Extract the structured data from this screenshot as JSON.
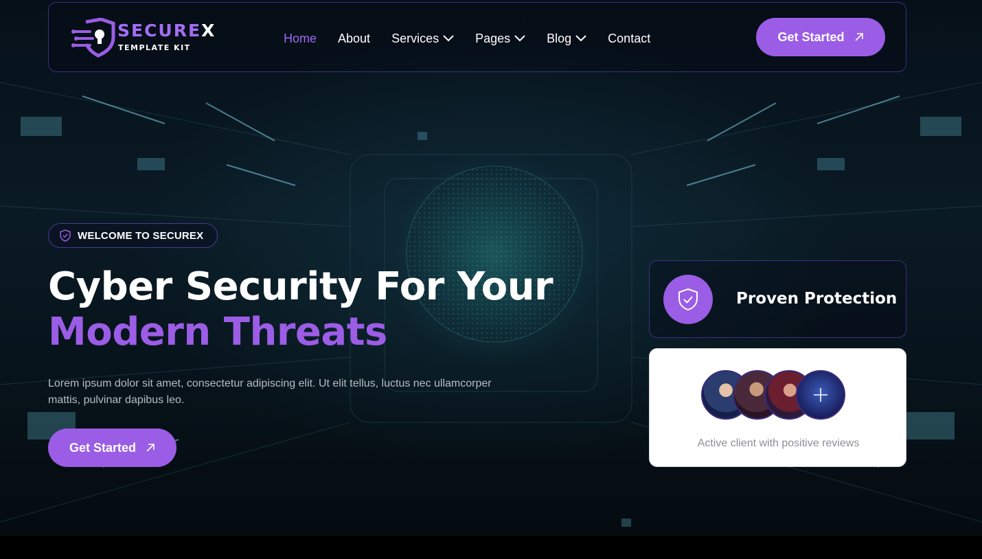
{
  "brand": {
    "name_main": "SECURE",
    "name_end": "X",
    "tagline": "TEMPLATE KIT",
    "accent": "#9b5de5"
  },
  "nav": {
    "items": [
      {
        "label": "Home",
        "active": true
      },
      {
        "label": "About"
      },
      {
        "label": "Services",
        "has_dropdown": true
      },
      {
        "label": "Pages",
        "has_dropdown": true
      },
      {
        "label": "Blog",
        "has_dropdown": true
      },
      {
        "label": "Contact"
      }
    ],
    "cta_label": "Get Started"
  },
  "hero": {
    "badge_label": "WELCOME TO SECUREX",
    "title_line1": "Cyber Security For Your",
    "title_line2": "Modern Threats",
    "lead": "Lorem ipsum dolor sit amet, consectetur adipiscing elit. Ut elit tellus, luctus nec ullamcorper mattis, pulvinar dapibus leo.",
    "cta_label": "Get Started"
  },
  "cards": {
    "protection_label": "Proven Protection",
    "clients_caption": "Active client with positive reviews",
    "avatar_icons": [
      "avatar-1",
      "avatar-2",
      "avatar-3",
      "plus-icon"
    ]
  }
}
